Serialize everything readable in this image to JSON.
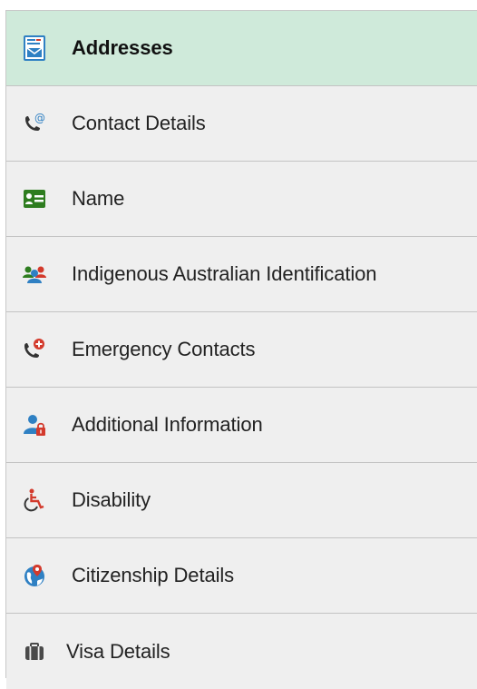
{
  "nav": {
    "items": [
      {
        "label": "Addresses",
        "icon": "address-card-envelope-icon",
        "active": true
      },
      {
        "label": "Contact Details",
        "icon": "phone-at-icon",
        "active": false
      },
      {
        "label": "Name",
        "icon": "name-card-icon",
        "active": false
      },
      {
        "label": "Indigenous Australian Identification",
        "icon": "people-group-icon",
        "active": false
      },
      {
        "label": "Emergency Contacts",
        "icon": "phone-emergency-icon",
        "active": false
      },
      {
        "label": "Additional Information",
        "icon": "person-lock-icon",
        "active": false
      },
      {
        "label": "Disability",
        "icon": "wheelchair-icon",
        "active": false
      },
      {
        "label": "Citizenship Details",
        "icon": "globe-pin-icon",
        "active": false
      },
      {
        "label": "Visa Details",
        "icon": "suitcase-icon",
        "active": false
      }
    ]
  },
  "colors": {
    "active_background": "#cfeada",
    "item_background": "#efefef",
    "divider": "#c3c3c3",
    "icon_blue": "#2f80c3",
    "icon_green": "#2e7d1f",
    "icon_red": "#d33a2c",
    "icon_dark": "#333333"
  }
}
